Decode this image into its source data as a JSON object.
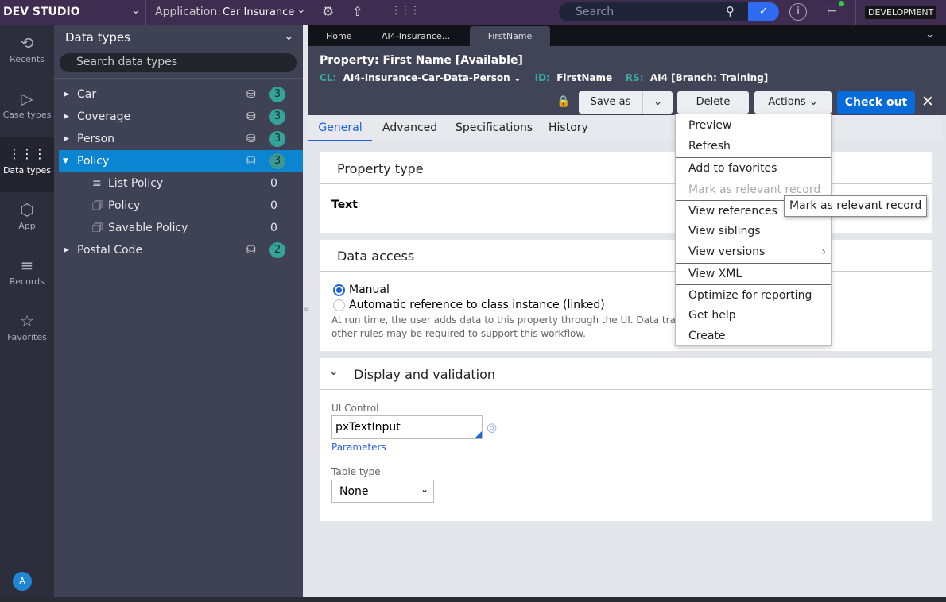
{
  "topbar": {
    "brand": "DEV STUDIO",
    "app_label": "Application:",
    "app_name": "Car Insurance",
    "search_placeholder": "Search",
    "env": "DEVELOPMENT",
    "status_color": "#2ecc40"
  },
  "leftnav": [
    {
      "label": "Recents",
      "icon": "history-icon"
    },
    {
      "label": "Case types",
      "icon": "case-types-icon"
    },
    {
      "label": "Data types",
      "icon": "grid-icon"
    },
    {
      "label": "App",
      "icon": "cube-icon"
    },
    {
      "label": "Records",
      "icon": "layers-icon"
    },
    {
      "label": "Favorites",
      "icon": "star-icon"
    }
  ],
  "avatar": "A",
  "panel": {
    "title": "Data types",
    "search_placeholder": "Search data types",
    "items": [
      {
        "label": "Car",
        "count": "3"
      },
      {
        "label": "Coverage",
        "count": "3"
      },
      {
        "label": "Person",
        "count": "3"
      },
      {
        "label": "Policy",
        "count": "3",
        "expanded": true,
        "selected": true
      },
      {
        "label": "Postal Code",
        "count": "2"
      }
    ],
    "children": [
      {
        "label": "List Policy",
        "count": "0",
        "icon": "list-icon"
      },
      {
        "label": "Policy",
        "count": "0",
        "icon": "page-icon"
      },
      {
        "label": "Savable Policy",
        "count": "0",
        "icon": "page-icon"
      }
    ]
  },
  "tabs": [
    {
      "label": "Home"
    },
    {
      "label": "AI4-Insurance..."
    },
    {
      "label": "FirstName",
      "active": true
    }
  ],
  "header": {
    "title": "Property: First Name",
    "status": "[Available]",
    "cl_label": "CL:",
    "cl": "AI4-Insurance-Car-Data-Person",
    "id_label": "ID:",
    "id": "FirstName",
    "rs_label": "RS:",
    "rs": "AI4 [Branch: Training]"
  },
  "toolbar": {
    "save_as": "Save as",
    "delete": "Delete",
    "actions": "Actions",
    "checkout": "Check out"
  },
  "subtabs": [
    {
      "label": "General",
      "active": true
    },
    {
      "label": "Advanced"
    },
    {
      "label": "Specifications"
    },
    {
      "label": "History"
    }
  ],
  "property_type": {
    "title": "Property type",
    "value": "Text"
  },
  "data_access": {
    "title": "Data access",
    "option1": "Manual",
    "option2": "Automatic reference to class instance (linked)",
    "help1": "At run time, the user adds data to this property through the UI. Data transfor",
    "help2": "other rules may be required to support this workflow."
  },
  "display": {
    "title": "Display and validation",
    "ui_control_label": "UI Control",
    "ui_control_value": "pxTextInput",
    "parameters": "Parameters",
    "table_type_label": "Table type",
    "table_type_value": "None"
  },
  "menu": [
    {
      "label": "Preview"
    },
    {
      "label": "Refresh"
    },
    {
      "label": "Add to favorites"
    },
    {
      "label": "Mark as relevant record",
      "disabled": true
    },
    {
      "label": "View references"
    },
    {
      "label": "View siblings"
    },
    {
      "label": "View versions"
    },
    {
      "label": "View XML"
    },
    {
      "label": "Optimize for reporting"
    },
    {
      "label": "Get help"
    },
    {
      "label": "Create"
    }
  ],
  "tooltip": "Mark as relevant record"
}
